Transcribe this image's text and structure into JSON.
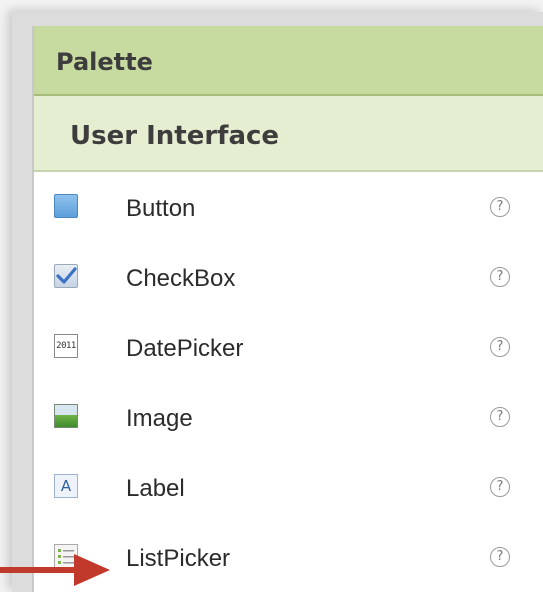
{
  "palette": {
    "title": "Palette"
  },
  "section": {
    "title": "User Interface"
  },
  "components": [
    {
      "label": "Button",
      "icon": "button-icon",
      "help": "?"
    },
    {
      "label": "CheckBox",
      "icon": "checkbox-icon",
      "help": "?"
    },
    {
      "label": "DatePicker",
      "icon": "datepicker-icon",
      "icon_text": "2011",
      "help": "?"
    },
    {
      "label": "Image",
      "icon": "image-icon",
      "help": "?"
    },
    {
      "label": "Label",
      "icon": "label-icon",
      "icon_text": "A",
      "help": "?"
    },
    {
      "label": "ListPicker",
      "icon": "listpicker-icon",
      "help": "?"
    }
  ],
  "annotation": {
    "arrow_color": "#c0392b",
    "points_to": "ListPicker"
  },
  "colors": {
    "palette_header": "#c7dba0",
    "section_header": "#e6eed2"
  }
}
